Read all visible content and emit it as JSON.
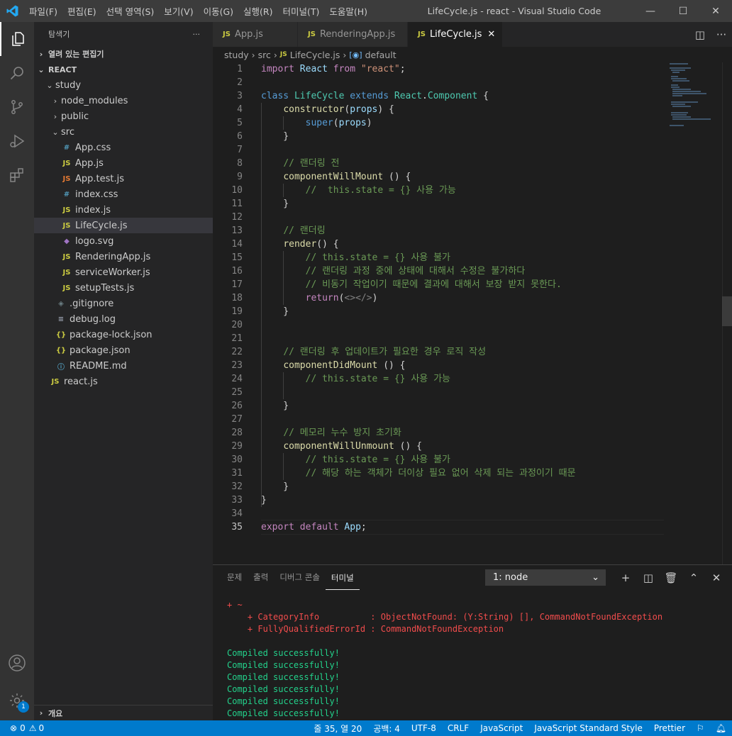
{
  "window": {
    "title": "LifeCycle.js - react - Visual Studio Code",
    "menu": [
      "파일(F)",
      "편집(E)",
      "선택 영역(S)",
      "보기(V)",
      "이동(G)",
      "실행(R)",
      "터미널(T)",
      "도움말(H)"
    ]
  },
  "activity": {
    "items": [
      "files-icon",
      "search-icon",
      "source-control-icon",
      "run-debug-icon",
      "extensions-icon"
    ],
    "bottom": [
      "account-icon",
      "settings-gear-icon"
    ],
    "settings_badge": "1"
  },
  "sidebar": {
    "title": "탐색기",
    "more": "···",
    "open_editors": "열려 있는 편집기",
    "project": "REACT",
    "outline": "개요",
    "tree": [
      {
        "label": "study",
        "type": "folder-open",
        "indent": 1
      },
      {
        "label": "node_modules",
        "type": "folder",
        "indent": 2
      },
      {
        "label": "public",
        "type": "folder",
        "indent": 2
      },
      {
        "label": "src",
        "type": "folder-open",
        "indent": 2
      },
      {
        "label": "App.css",
        "type": "css",
        "indent": 3
      },
      {
        "label": "App.js",
        "type": "js",
        "indent": 3
      },
      {
        "label": "App.test.js",
        "type": "test",
        "indent": 3
      },
      {
        "label": "index.css",
        "type": "css",
        "indent": 3
      },
      {
        "label": "index.js",
        "type": "js",
        "indent": 3
      },
      {
        "label": "LifeCycle.js",
        "type": "js",
        "indent": 3,
        "selected": true
      },
      {
        "label": "logo.svg",
        "type": "svg",
        "indent": 3
      },
      {
        "label": "RenderingApp.js",
        "type": "js",
        "indent": 3
      },
      {
        "label": "serviceWorker.js",
        "type": "js",
        "indent": 3
      },
      {
        "label": "setupTests.js",
        "type": "js",
        "indent": 3
      },
      {
        "label": ".gitignore",
        "type": "git",
        "indent": 2
      },
      {
        "label": "debug.log",
        "type": "log",
        "indent": 2
      },
      {
        "label": "package-lock.json",
        "type": "json",
        "indent": 2
      },
      {
        "label": "package.json",
        "type": "json",
        "indent": 2
      },
      {
        "label": "README.md",
        "type": "info",
        "indent": 2
      },
      {
        "label": "react.js",
        "type": "js",
        "indent": 1
      }
    ]
  },
  "tabs": [
    {
      "label": "App.js",
      "active": false
    },
    {
      "label": "RenderingApp.js",
      "active": false
    },
    {
      "label": "LifeCycle.js",
      "active": true
    }
  ],
  "breadcrumb": [
    "study",
    "src",
    "LifeCycle.js",
    "default"
  ],
  "editor": {
    "lines": [
      [
        [
          "kwc",
          "import"
        ],
        [
          "pl",
          " "
        ],
        [
          "var",
          "React"
        ],
        [
          "pl",
          " "
        ],
        [
          "kwc",
          "from"
        ],
        [
          "pl",
          " "
        ],
        [
          "str",
          "\"react\""
        ],
        [
          "pl",
          ";"
        ]
      ],
      [],
      [
        [
          "kw",
          "class"
        ],
        [
          "pl",
          " "
        ],
        [
          "cls",
          "LifeCycle"
        ],
        [
          "pl",
          " "
        ],
        [
          "kw",
          "extends"
        ],
        [
          "pl",
          " "
        ],
        [
          "cls",
          "React"
        ],
        [
          "pl",
          "."
        ],
        [
          "cls",
          "Component"
        ],
        [
          "pl",
          " {"
        ]
      ],
      [
        [
          "pl",
          "    "
        ],
        [
          "fn",
          "constructor"
        ],
        [
          "pl",
          "("
        ],
        [
          "var",
          "props"
        ],
        [
          "pl",
          ") {"
        ]
      ],
      [
        [
          "pl",
          "        "
        ],
        [
          "kw",
          "super"
        ],
        [
          "pl",
          "("
        ],
        [
          "var",
          "props"
        ],
        [
          "pl",
          ")"
        ]
      ],
      [
        [
          "pl",
          "    }"
        ]
      ],
      [],
      [
        [
          "pl",
          "    "
        ],
        [
          "cm",
          "// 랜더링 전"
        ]
      ],
      [
        [
          "pl",
          "    "
        ],
        [
          "fn",
          "componentWillMount"
        ],
        [
          "pl",
          " () {"
        ]
      ],
      [
        [
          "pl",
          "        "
        ],
        [
          "cm",
          "//  this.state = {} 사용 가능"
        ]
      ],
      [
        [
          "pl",
          "    }"
        ]
      ],
      [],
      [
        [
          "pl",
          "    "
        ],
        [
          "cm",
          "// 랜더링"
        ]
      ],
      [
        [
          "pl",
          "    "
        ],
        [
          "fn",
          "render"
        ],
        [
          "pl",
          "() {"
        ]
      ],
      [
        [
          "pl",
          "        "
        ],
        [
          "cm",
          "// this.state = {} 사용 불가"
        ]
      ],
      [
        [
          "pl",
          "        "
        ],
        [
          "cm",
          "// 랜더링 과정 중에 상태에 대해서 수정은 불가하다"
        ]
      ],
      [
        [
          "pl",
          "        "
        ],
        [
          "cm",
          "// 비동기 작업이기 때문에 결과에 대해서 보장 받지 못한다."
        ]
      ],
      [
        [
          "pl",
          "        "
        ],
        [
          "kwc",
          "return"
        ],
        [
          "pl",
          "("
        ],
        [
          "tag",
          "<></>"
        ],
        [
          "pl",
          ")"
        ]
      ],
      [
        [
          "pl",
          "    }"
        ]
      ],
      [],
      [],
      [
        [
          "pl",
          "    "
        ],
        [
          "cm",
          "// 랜더링 후 업데이트가 필요한 경우 로직 작성"
        ]
      ],
      [
        [
          "pl",
          "    "
        ],
        [
          "fn",
          "componentDidMount"
        ],
        [
          "pl",
          " () {"
        ]
      ],
      [
        [
          "pl",
          "        "
        ],
        [
          "cm",
          "// this.state = {} 사용 가능"
        ]
      ],
      [],
      [
        [
          "pl",
          "    }"
        ]
      ],
      [],
      [
        [
          "pl",
          "    "
        ],
        [
          "cm",
          "// 메모리 누수 방지 초기화"
        ]
      ],
      [
        [
          "pl",
          "    "
        ],
        [
          "fn",
          "componentWillUnmount"
        ],
        [
          "pl",
          " () {"
        ]
      ],
      [
        [
          "pl",
          "        "
        ],
        [
          "cm",
          "// this.state = {} 사용 불가"
        ]
      ],
      [
        [
          "pl",
          "        "
        ],
        [
          "cm",
          "// 해당 하는 객체가 더이상 필요 없어 삭제 되는 과정이기 때문"
        ]
      ],
      [
        [
          "pl",
          "    }"
        ]
      ],
      [
        [
          "pl",
          "}"
        ]
      ],
      [],
      [
        [
          "kwc",
          "export"
        ],
        [
          "pl",
          " "
        ],
        [
          "kwc",
          "default"
        ],
        [
          "pl",
          " "
        ],
        [
          "var",
          "App"
        ],
        [
          "pl",
          ";"
        ]
      ]
    ]
  },
  "panel": {
    "tabs": [
      "문제",
      "출력",
      "디버그 콘솔",
      "터미널"
    ],
    "active_tab": "터미널",
    "terminal_select": "1: node",
    "actions": [
      "add-terminal-icon",
      "split-terminal-icon",
      "trash-icon",
      "maximize-icon",
      "close-panel-icon"
    ],
    "lines": [
      {
        "kind": "err",
        "text": "+ ~"
      },
      {
        "kind": "err",
        "text": "    + CategoryInfo          : ObjectNotFound: (Y:String) [], CommandNotFoundException"
      },
      {
        "kind": "err",
        "text": "    + FullyQualifiedErrorId : CommandNotFoundException"
      },
      {
        "kind": "blank",
        "text": ""
      },
      {
        "kind": "ok",
        "text": "Compiled successfully!"
      },
      {
        "kind": "ok",
        "text": "Compiled successfully!"
      },
      {
        "kind": "ok",
        "text": "Compiled successfully!"
      },
      {
        "kind": "ok",
        "text": "Compiled successfully!"
      },
      {
        "kind": "ok",
        "text": "Compiled successfully!"
      },
      {
        "kind": "ok",
        "text": "Compiled successfully!"
      }
    ]
  },
  "status": {
    "errors": "0",
    "warnings": "0",
    "position": "줄 35, 열 20",
    "spaces": "공백: 4",
    "encoding": "UTF-8",
    "eol": "CRLF",
    "language": "JavaScript",
    "linter": "JavaScript Standard Style",
    "formatter": "Prettier"
  },
  "colors": {
    "accent": "#007acc",
    "js_icon": "#cbcb41",
    "css_icon": "#519aba",
    "error": "#f14c4c",
    "success": "#23d18b"
  }
}
